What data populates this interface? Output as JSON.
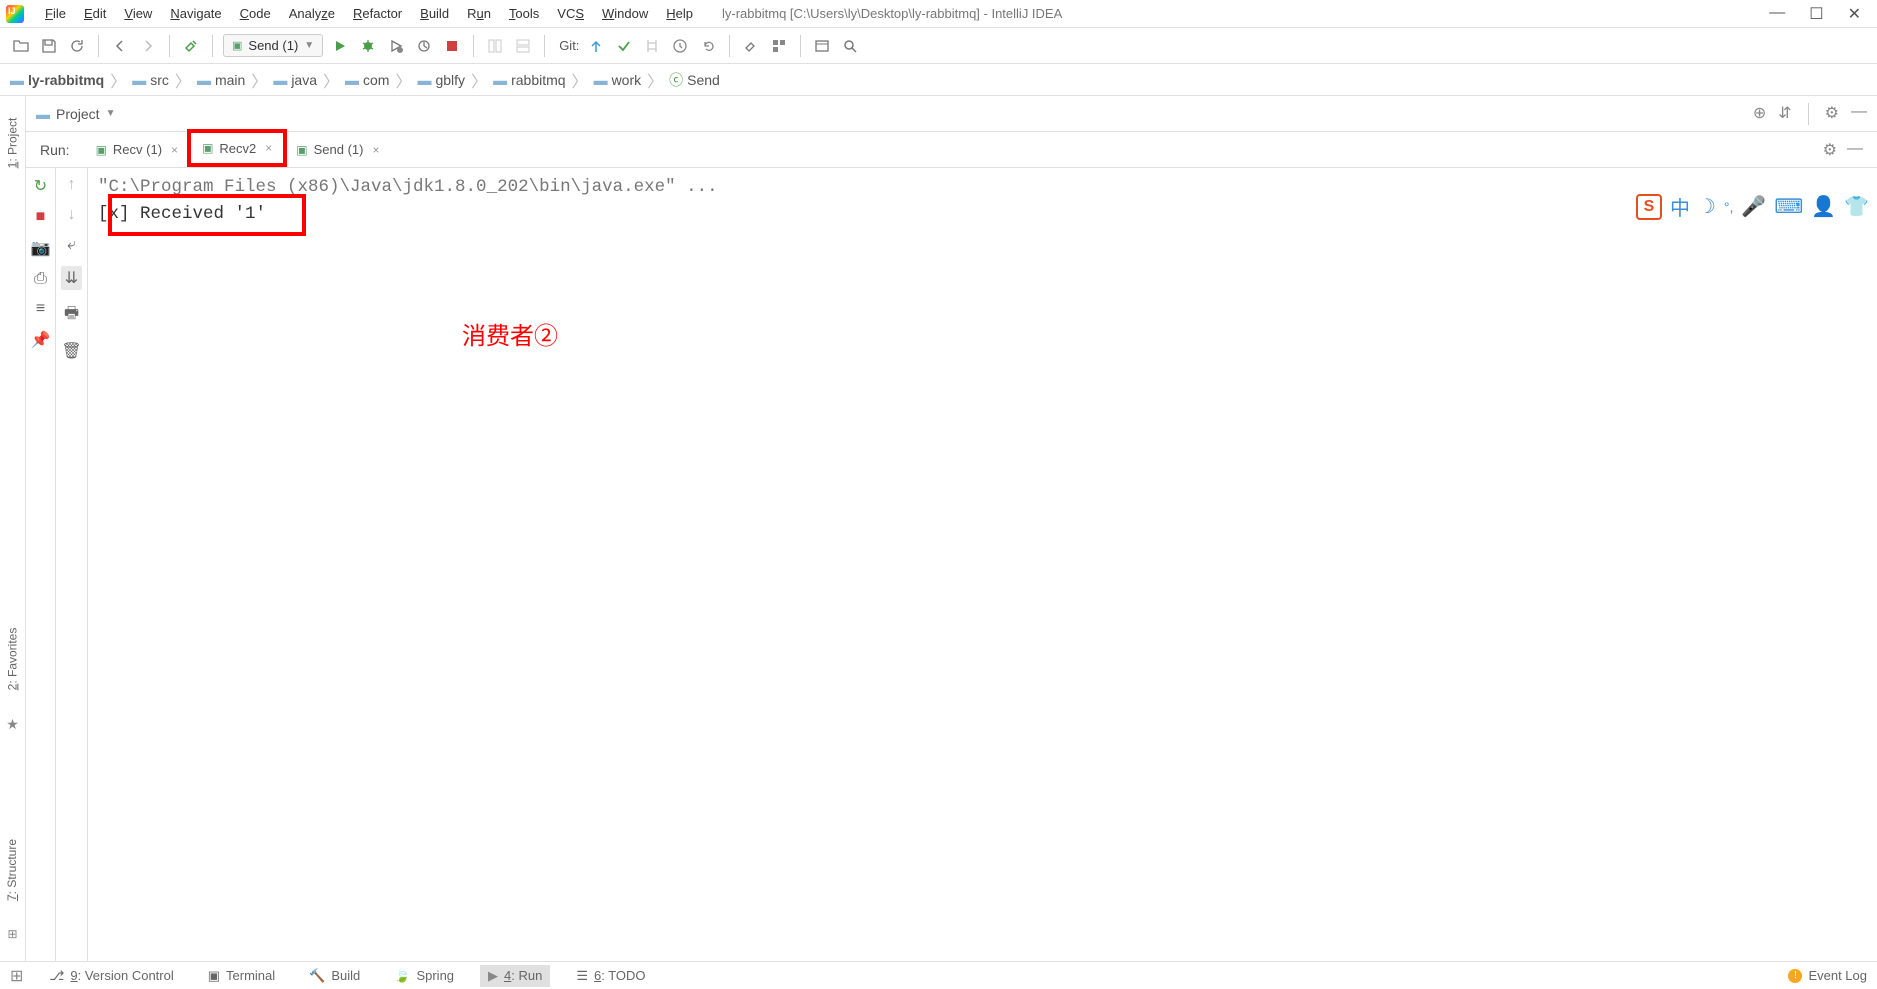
{
  "menu": {
    "items": [
      "File",
      "Edit",
      "View",
      "Navigate",
      "Code",
      "Analyze",
      "Refactor",
      "Build",
      "Run",
      "Tools",
      "VCS",
      "Window",
      "Help"
    ]
  },
  "title": "ly-rabbitmq [C:\\Users\\ly\\Desktop\\ly-rabbitmq] - IntelliJ IDEA",
  "runConfig": "Send (1)",
  "gitLabel": "Git:",
  "breadcrumb": [
    "ly-rabbitmq",
    "src",
    "main",
    "java",
    "com",
    "gblfy",
    "rabbitmq",
    "work",
    "Send"
  ],
  "sideTabs": {
    "project": "1: Project",
    "favorites": "2: Favorites",
    "structure": "7: Structure"
  },
  "projectPanel": {
    "label": "Project"
  },
  "runPanel": {
    "title": "Run:",
    "tabs": [
      {
        "label": "Recv (1)",
        "active": false
      },
      {
        "label": "Recv2",
        "active": true,
        "highlight": true
      },
      {
        "label": "Send (1)",
        "active": false
      }
    ],
    "console": {
      "line1": "\"C:\\Program Files (x86)\\Java\\jdk1.8.0_202\\bin\\java.exe\" ...",
      "line2": "[x] Received '1'"
    }
  },
  "annotation": "消费者②",
  "bottomBar": {
    "items": [
      {
        "label": "9: Version Control",
        "icon": "branch"
      },
      {
        "label": "Terminal",
        "icon": "terminal"
      },
      {
        "label": "Build",
        "icon": "hammer"
      },
      {
        "label": "Spring",
        "icon": "leaf"
      },
      {
        "label": "4: Run",
        "icon": "play",
        "active": true
      },
      {
        "label": "6: TODO",
        "icon": "list"
      }
    ],
    "eventLog": "Event Log"
  },
  "ime": {
    "zhong": "中"
  }
}
